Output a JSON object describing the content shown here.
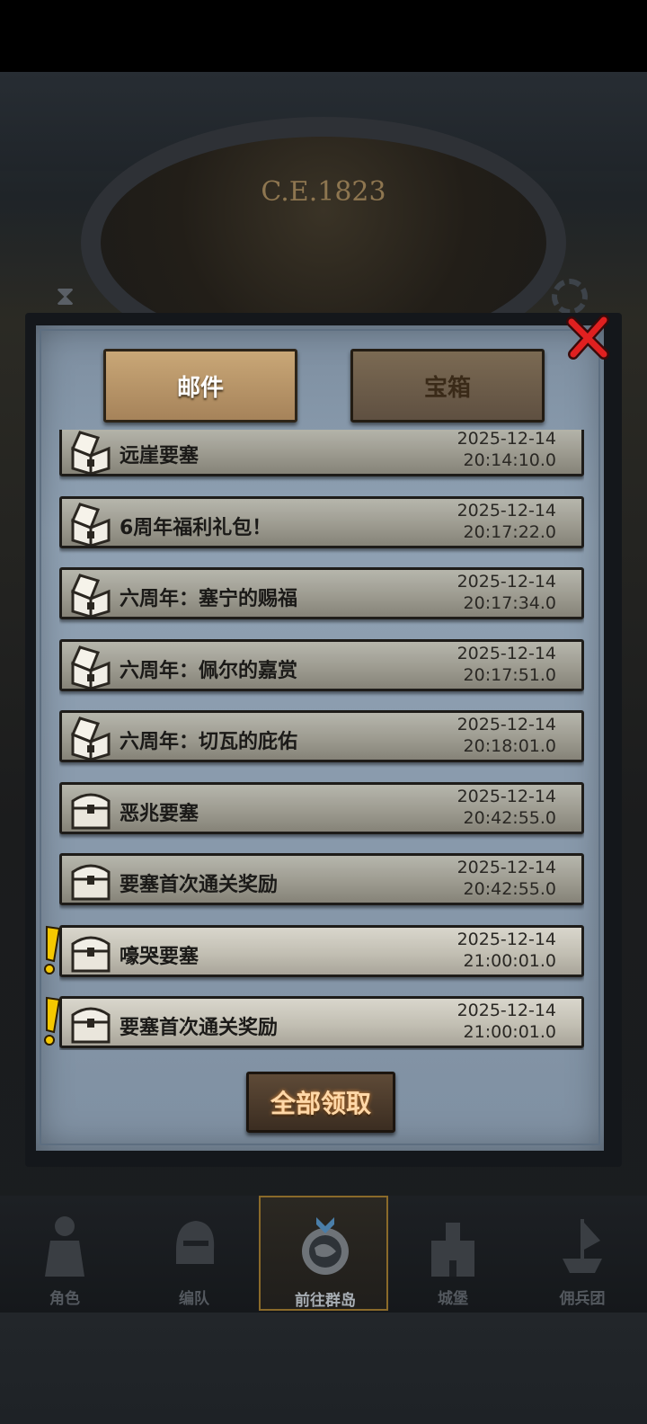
{
  "header": {
    "era": "C.E.1823"
  },
  "modal": {
    "tabs": [
      {
        "label": "邮件",
        "active": true
      },
      {
        "label": "宝箱",
        "active": false
      }
    ],
    "mails": [
      {
        "title": "远崖要塞",
        "date": "2025-12-14",
        "time": "20:14:10.0",
        "icon": "open-chest-icon",
        "alert": false,
        "highlight": false
      },
      {
        "title": "6周年福利礼包！",
        "date": "2025-12-14",
        "time": "20:17:22.0",
        "icon": "open-chest-icon",
        "alert": false,
        "highlight": false
      },
      {
        "title": "六周年：塞宁的赐福",
        "date": "2025-12-14",
        "time": "20:17:34.0",
        "icon": "open-chest-icon",
        "alert": false,
        "highlight": false
      },
      {
        "title": "六周年：佩尔的嘉赏",
        "date": "2025-12-14",
        "time": "20:17:51.0",
        "icon": "open-chest-icon",
        "alert": false,
        "highlight": false
      },
      {
        "title": "六周年：切瓦的庇佑",
        "date": "2025-12-14",
        "time": "20:18:01.0",
        "icon": "open-chest-icon",
        "alert": false,
        "highlight": false
      },
      {
        "title": "恶兆要塞",
        "date": "2025-12-14",
        "time": "20:42:55.0",
        "icon": "closed-chest-icon",
        "alert": false,
        "highlight": false
      },
      {
        "title": "要塞首次通关奖励",
        "date": "2025-12-14",
        "time": "20:42:55.0",
        "icon": "closed-chest-icon",
        "alert": false,
        "highlight": false
      },
      {
        "title": "嚎哭要塞",
        "date": "2025-12-14",
        "time": "21:00:01.0",
        "icon": "closed-chest-icon",
        "alert": true,
        "highlight": true
      },
      {
        "title": "要塞首次通关奖励",
        "date": "2025-12-14",
        "time": "21:00:01.0",
        "icon": "closed-chest-icon",
        "alert": true,
        "highlight": true
      }
    ],
    "claim_all_label": "全部领取"
  },
  "nav": [
    {
      "label": "角色",
      "icon": "knight-icon",
      "active": false
    },
    {
      "label": "编队",
      "icon": "helmet-icon",
      "active": false
    },
    {
      "label": "前往群岛",
      "icon": "compass-globe-icon",
      "active": true
    },
    {
      "label": "城堡",
      "icon": "castle-icon",
      "active": false
    },
    {
      "label": "佣兵团",
      "icon": "ship-icon",
      "active": false
    }
  ],
  "colors": {
    "accent": "#ffd8a8",
    "alert": "#f5c800",
    "close": "#e02020"
  }
}
